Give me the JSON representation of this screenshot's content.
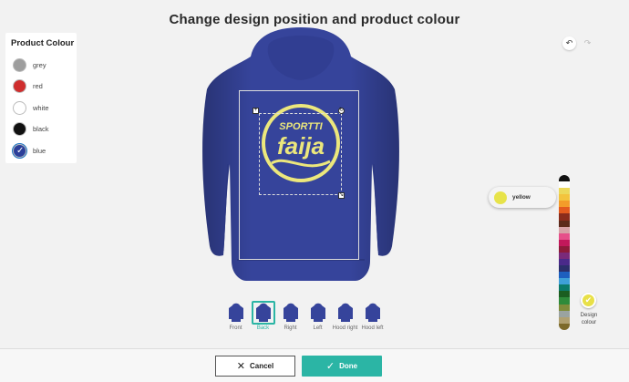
{
  "page": {
    "title": "Change design position and product colour"
  },
  "product_colour": {
    "heading": "Product Colour",
    "options": [
      {
        "label": "grey",
        "color": "#9e9e9e",
        "selected": false
      },
      {
        "label": "red",
        "color": "#cf2e2e",
        "selected": false
      },
      {
        "label": "white",
        "color": "#ffffff",
        "selected": false
      },
      {
        "label": "black",
        "color": "#111111",
        "selected": false
      },
      {
        "label": "blue",
        "color": "#2b3f9a",
        "selected": true
      }
    ]
  },
  "toolbar": {
    "undo_icon": "undo-icon",
    "redo_icon": "redo-icon"
  },
  "product": {
    "color": "#36449b",
    "design_color": "#ece77c"
  },
  "design": {
    "line1": "SPORTTI",
    "line2": "faija"
  },
  "views": [
    {
      "label": "Front",
      "active": false
    },
    {
      "label": "Back",
      "active": true
    },
    {
      "label": "Right",
      "active": false
    },
    {
      "label": "Left",
      "active": false
    },
    {
      "label": "Hood right",
      "active": false
    },
    {
      "label": "Hood left",
      "active": false
    }
  ],
  "design_palette": {
    "selected_name": "yellow",
    "selected_color": "#e7e34a",
    "colors": [
      "#111111",
      "#ffffff",
      "#ecd95a",
      "#f3c43d",
      "#f39c2a",
      "#e35b1f",
      "#8a2c1c",
      "#5c2a1a",
      "#d7a3a8",
      "#e6508a",
      "#c2185b",
      "#8e1a3a",
      "#7a2a7a",
      "#4a2a8a",
      "#2b2f6b",
      "#1e5fbf",
      "#3fa0d8",
      "#0c7a6a",
      "#1b5e20",
      "#2e8b3a",
      "#7f8c3a",
      "#9aa3a0",
      "#b0a070",
      "#7d6a2a"
    ]
  },
  "design_colour_button": {
    "label": "Design colour"
  },
  "footer": {
    "cancel_label": "Cancel",
    "done_label": "Done"
  }
}
